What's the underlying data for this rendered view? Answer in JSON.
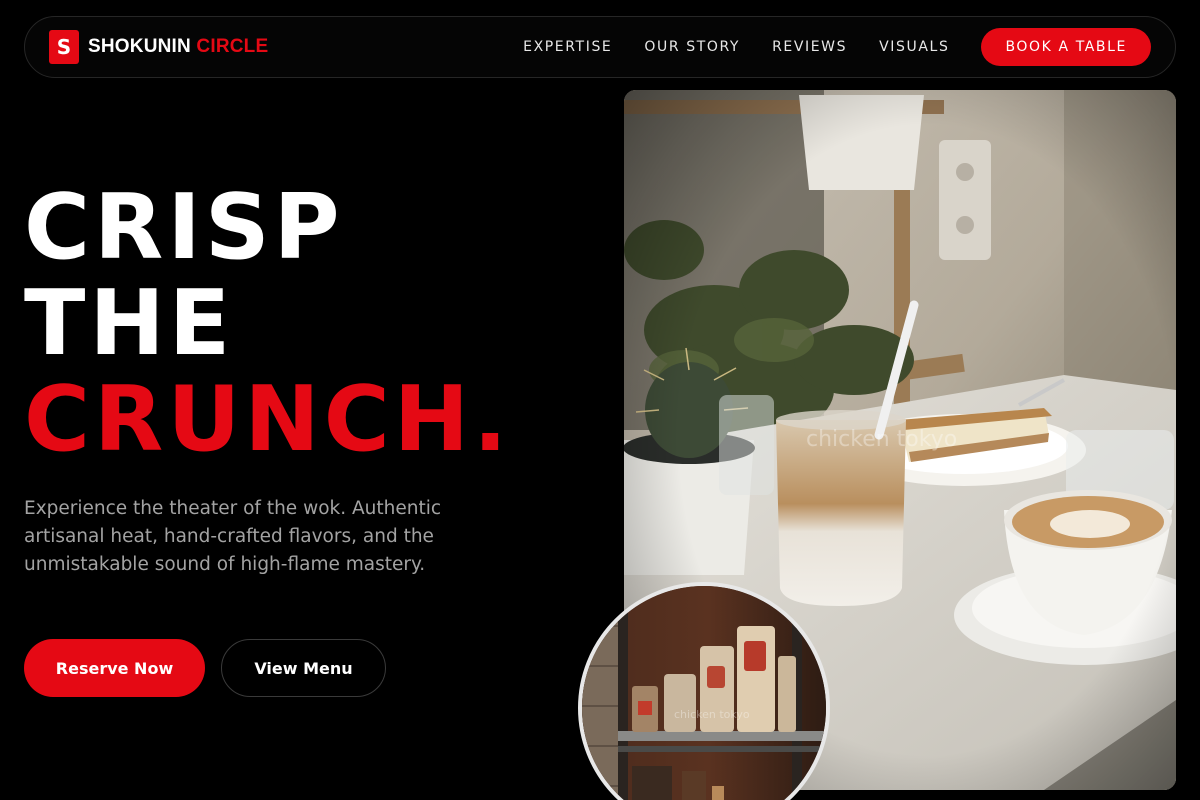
{
  "brand": {
    "mark": "S",
    "name_part1": "SHOKUNIN",
    "name_part2": "CIRCLE"
  },
  "nav": {
    "links": [
      "EXPERTISE",
      "OUR STORY",
      "REVIEWS",
      "VISUALS"
    ],
    "book_label": "BOOK A TABLE"
  },
  "hero": {
    "headline_line1": "CRISP",
    "headline_line2": "THE",
    "headline_line3": "CRUNCH.",
    "subcopy": "Experience the theater of the wok. Authentic artisanal heat, hand-crafted flavors, and the unmistakable sound of high-flame mastery.",
    "primary_cta": "Reserve Now",
    "secondary_cta": "View Menu"
  },
  "images": {
    "main_watermark": "chicken tokyo",
    "circle_watermark": "chicken tokyo"
  },
  "colors": {
    "accent": "#e50914",
    "background": "#000000",
    "muted_text": "#a3a3a3"
  }
}
